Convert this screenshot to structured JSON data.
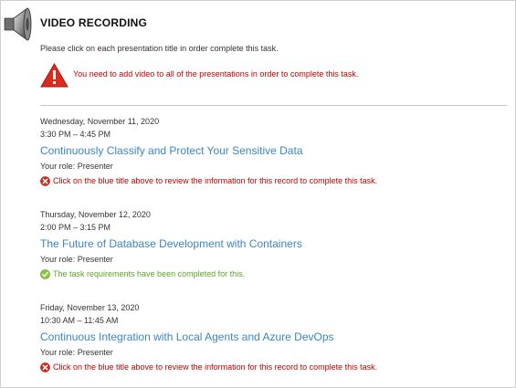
{
  "header": {
    "title": "VIDEO RECORDING",
    "icon": "speaker-icon"
  },
  "instructions": "Please click on each presentation title in order complete this task.",
  "warning": {
    "icon": "warning-triangle-icon",
    "text": "You need to add video to all of the presentations in order to complete this task.",
    "color": "#c00000"
  },
  "colors": {
    "link": "#3a87c2",
    "error": "#c00000",
    "success": "#5aa52a"
  },
  "sessions": [
    {
      "date": "Wednesday, November 11, 2020",
      "time": "3:30 PM – 4:45 PM",
      "title": "Continuously Classify and Protect Your Sensitive Data",
      "role": "Your role: Presenter",
      "status_type": "error",
      "status_icon": "error-x-icon",
      "status_text": "Click on the blue title above to review the information for this record to complete this task."
    },
    {
      "date": "Thursday, November 12, 2020",
      "time": "2:00 PM – 3:15 PM",
      "title": "The Future of Database Development with Containers",
      "role": "Your role: Presenter",
      "status_type": "success",
      "status_icon": "check-icon",
      "status_text": "The task requirements have been completed for this."
    },
    {
      "date": "Friday, November 13, 2020",
      "time": "10:30 AM – 11:45 AM",
      "title": "Continuous Integration with Local Agents and Azure DevOps",
      "role": "Your role: Presenter",
      "status_type": "error",
      "status_icon": "error-x-icon",
      "status_text": "Click on the blue title above to review the information for this record to complete this task."
    }
  ]
}
